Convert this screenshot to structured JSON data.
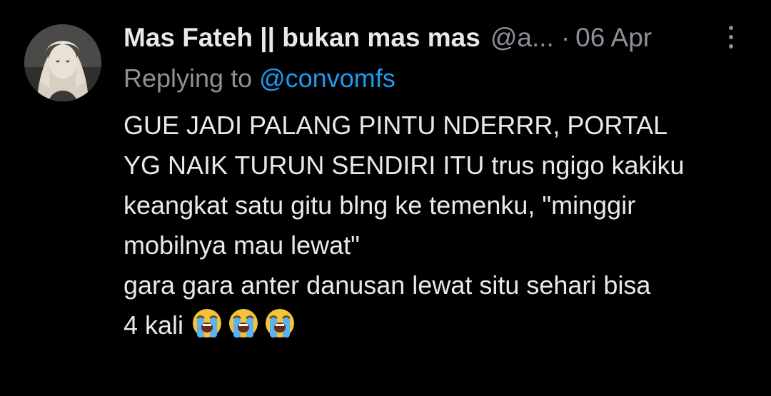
{
  "tweet": {
    "author": {
      "display_name": "Mas Fateh || bukan mas mas",
      "handle": "@a...",
      "avatar_icon": "profile-avatar"
    },
    "separator": "·",
    "date": "06 Apr",
    "more_icon": "more-vertical-icon",
    "replying": {
      "prefix": "Replying to",
      "mention": "@convomfs"
    },
    "body_lines": [
      "GUE JADI PALANG PINTU NDERRR, PORTAL",
      "YG NAIK TURUN SENDIRI ITU trus ngigo kakiku",
      "keangkat satu gitu blng ke temenku, \"minggir",
      "mobilnya mau lewat\"",
      "gara gara anter danusan lewat situ sehari bisa",
      "4 kali"
    ],
    "emojis": [
      "loudly-crying-face",
      "loudly-crying-face",
      "loudly-crying-face"
    ]
  },
  "colors": {
    "background": "#000000",
    "text_primary": "#e7e9ea",
    "text_secondary": "#8b9197",
    "link": "#1d9bf0"
  }
}
